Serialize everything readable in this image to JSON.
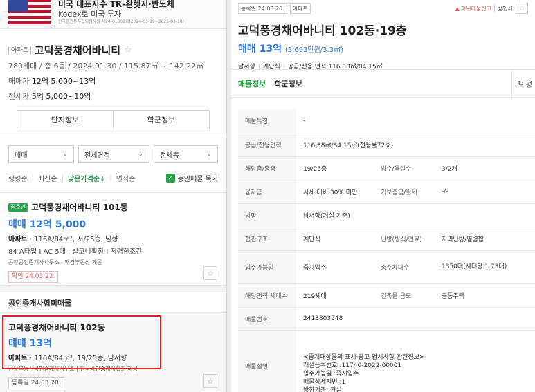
{
  "ad": {
    "title": "미국 대표지수 TR-환헷지·반도체",
    "subtitle": "Kodex로 미국 투자",
    "note": "한국증권투자협회심사필 제24-01002호(2024-03-19~2025-03-18)"
  },
  "complex": {
    "tag": "아파트",
    "name": "고덕풍경채어바니티",
    "meta": "780세대 / 총 6동 / 2024.01.30 / 115.87㎡ ~ 142.22㎡",
    "sale_label": "매매가",
    "sale_value": "12억 5,000~13억",
    "rent_label": "전세가",
    "rent_value": "5억 5,000~10억",
    "tab_complex": "단지정보",
    "tab_school": "학군정보"
  },
  "filters": {
    "trade": "매매",
    "area": "전체면적",
    "dong": "전체동"
  },
  "sort": {
    "ranking": "랭킹순",
    "latest": "최신순",
    "lowest": "낮은가격순↓",
    "area": "면적순",
    "group_same": "동일매물 묶기"
  },
  "listing1": {
    "tag": "집주인",
    "name": "고덕풍경채어바니티 101동",
    "price": "매매 12억 5,000",
    "desc_bold": "아파트",
    "desc": " · 116A/84m², 저/25층, 남향",
    "desc2": "84 A타입 I AC 5대 I 발코니확장 I 저렴한조건",
    "agent": "공간공인중개사사무소 | 매경부동산 제공",
    "confirm": "확인 24.03.22."
  },
  "group": {
    "title": "공인중개사협회매물"
  },
  "listing2": {
    "name": "고덕풍경채어바니티 102동",
    "price": "매매 13억",
    "desc_bold": "아파트",
    "desc": " · 116A/84m², 19/25층, 남서향",
    "agent": "선우부동산공인중개사사무소 | 한국공인중개사협회 제공",
    "date": "등록일 24.03.20."
  },
  "detail": {
    "reg_date": "등록일 24.03.20.",
    "type": "아파트",
    "report": "허위매물신고",
    "print": "인쇄",
    "title": "고덕풍경채어바니티 102동·19층",
    "price": "매매 13억",
    "price_sub": "(3,693만원/3.3㎡)",
    "meta1": "남서향",
    "meta2": "계단식",
    "meta3": "공급/전용 면적:116.38㎡/84.15㎡",
    "tab_info": "매물정보",
    "tab_school": "학군정보",
    "refresh": "평"
  },
  "info": {
    "feature_k": "매물특징",
    "feature_v": "-",
    "area_k": "공급/전용면적",
    "area_v": "116.38㎡/84.15㎡(전용률72%)",
    "floor_k": "해당층/총층",
    "floor_v": "19/25층",
    "rooms_k": "방수/욕실수",
    "rooms_v": "3/2개",
    "loan_k": "융자금",
    "loan_v": "시세 대비 30% 미만",
    "deposit_k": "기보증금/월세",
    "deposit_v": "-/-",
    "dir_k": "방향",
    "dir_v": "남서향(거실 기준)",
    "struct_k": "현관구조",
    "struct_v": "계단식",
    "heat_k": "난방(방식/연료)",
    "heat_v": "지역난방/열병합",
    "move_k": "입주가능일",
    "move_v": "즉시입주",
    "park_k": "총주차대수",
    "park_v": "1350대(세대당 1.73대)",
    "units_k": "해당면적 세대수",
    "units_v": "219세대",
    "use_k": "건축물 용도",
    "use_v": "공동주택",
    "no_k": "매물번호",
    "no_v": "2413803548",
    "desc_k": "매물설명",
    "desc_l1": "<중개대상물의 표시·광고 명시사항 관련정보>",
    "desc_l2": "개설등록번호 :11740-2022-00001",
    "desc_l3": "입주가능일 :즉시입주",
    "desc_l4": "매물상세지번 :1",
    "desc_l5": "방향기준 :거실"
  }
}
